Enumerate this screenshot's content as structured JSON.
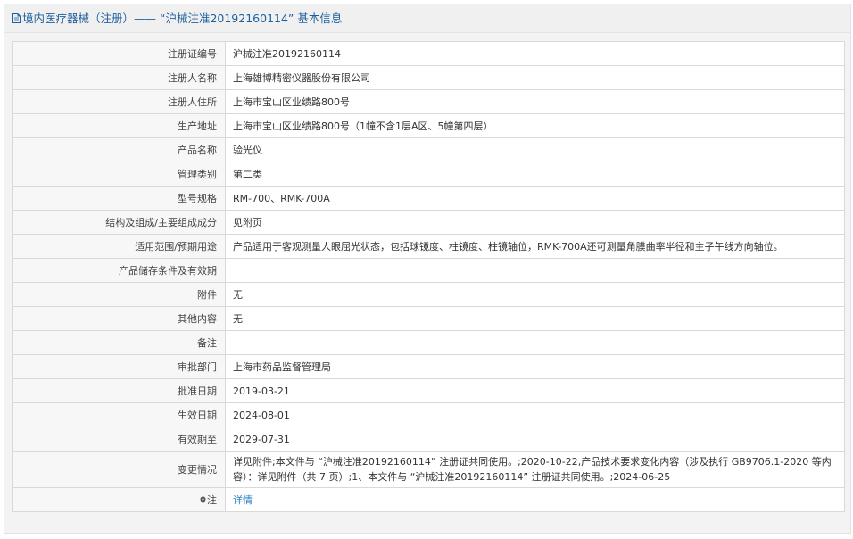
{
  "header": {
    "title": "境内医疗器械（注册）—— “沪械注准20192160114” 基本信息"
  },
  "rows": [
    {
      "label": "注册证编号",
      "value": "沪械注准20192160114"
    },
    {
      "label": "注册人名称",
      "value": "上海雄博精密仪器股份有限公司"
    },
    {
      "label": "注册人住所",
      "value": "上海市宝山区业绩路800号"
    },
    {
      "label": "生产地址",
      "value": "上海市宝山区业绩路800号（1幢不含1层A区、5幢第四层）"
    },
    {
      "label": "产品名称",
      "value": "验光仪"
    },
    {
      "label": "管理类别",
      "value": "第二类"
    },
    {
      "label": "型号规格",
      "value": "RM-700、RMK-700A"
    },
    {
      "label": "结构及组成/主要组成成分",
      "value": "见附页"
    },
    {
      "label": "适用范围/预期用途",
      "value": "产品适用于客观测量人眼屈光状态，包括球镜度、柱镜度、柱镜轴位，RMK-700A还可测量角膜曲率半径和主子午线方向轴位。"
    },
    {
      "label": "产品储存条件及有效期",
      "value": ""
    },
    {
      "label": "附件",
      "value": "无"
    },
    {
      "label": "其他内容",
      "value": "无"
    },
    {
      "label": "备注",
      "value": ""
    },
    {
      "label": "审批部门",
      "value": "上海市药品监督管理局"
    },
    {
      "label": "批准日期",
      "value": "2019-03-21"
    },
    {
      "label": "生效日期",
      "value": "2024-08-01"
    },
    {
      "label": "有效期至",
      "value": "2029-07-31"
    },
    {
      "label": "变更情况",
      "value": "详见附件;本文件与 “沪械注准20192160114” 注册证共同使用。;2020-10-22,产品技术要求变化内容（涉及执行 GB9706.1-2020 等内容）：详见附件（共 7 页）;1、本文件与 “沪械注准20192160114” 注册证共同使用。;2024-06-25"
    }
  ],
  "note": {
    "label": "注",
    "link_text": "详情"
  },
  "colors": {
    "title": "#1f5f9e",
    "link": "#2a7fc1",
    "border": "#d9d9d9",
    "label_bg": "#f7f7f7"
  }
}
